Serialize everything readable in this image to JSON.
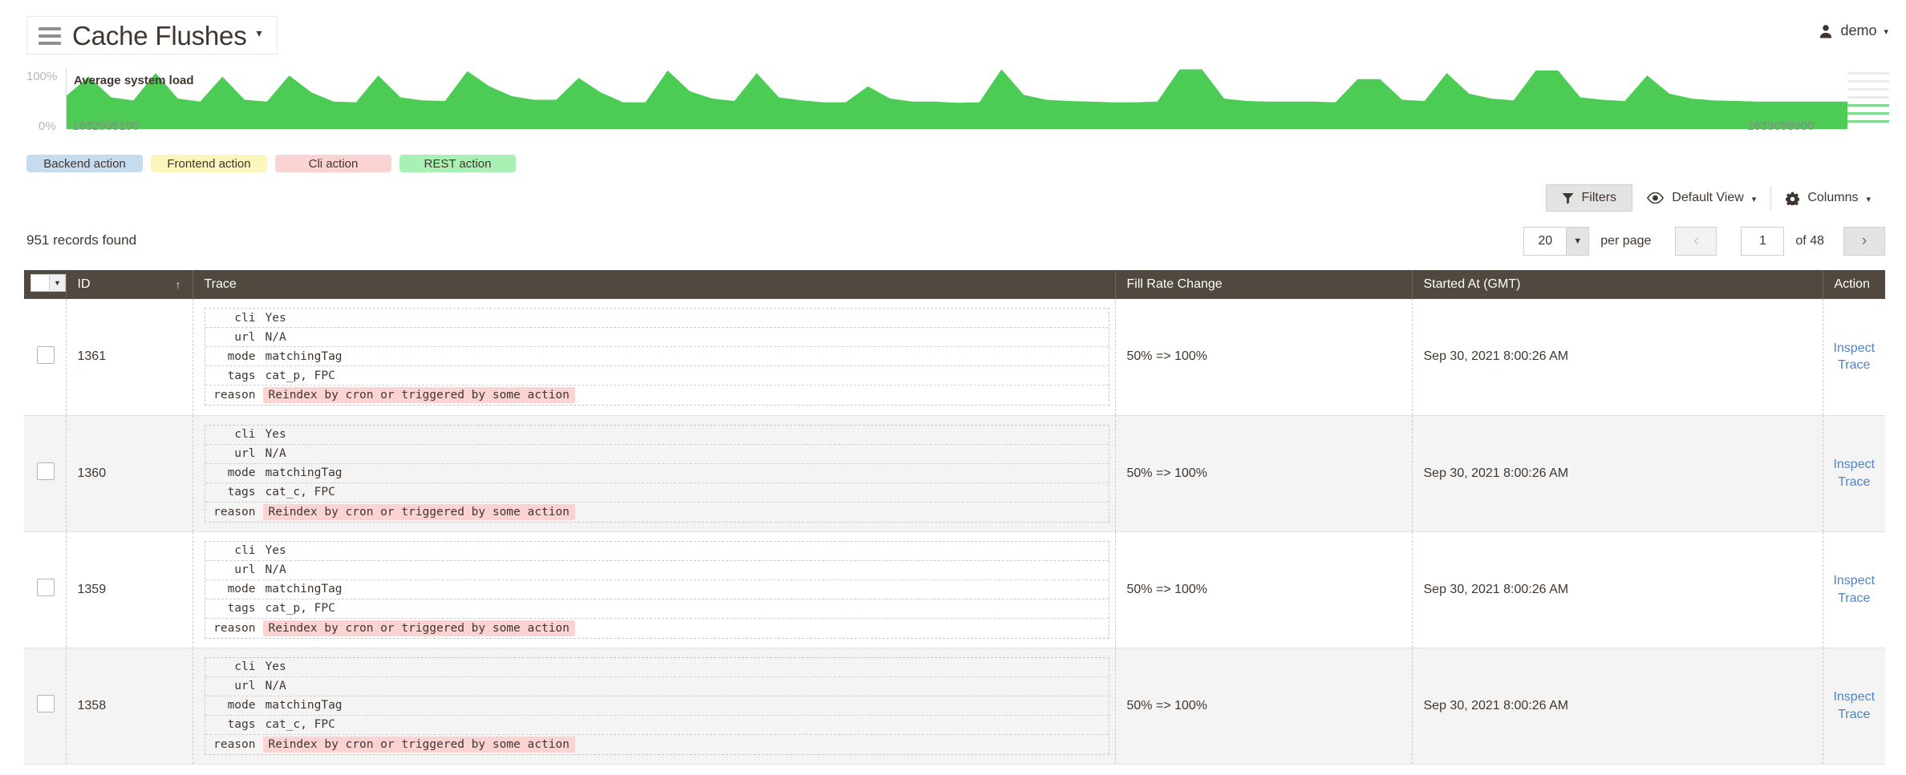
{
  "header": {
    "title": "Cache Flushes",
    "title_caret": "▾",
    "menu_icon": "hamburger-icon",
    "user": {
      "name": "demo",
      "caret": "▾",
      "icon": "user-avatar-icon"
    }
  },
  "chart_data": {
    "type": "area",
    "title": "Average system load",
    "ylabel": "",
    "xlabel": "",
    "y_tick_labels": [
      "100%",
      "0%"
    ],
    "ylim": [
      0,
      100
    ],
    "grid": false,
    "legend_position": "below",
    "series_color": "#4ccb55",
    "x_tick_labels": [
      "1632905100",
      "1633098900"
    ],
    "x": [
      1632905100,
      1633098900
    ],
    "values": [
      55,
      86,
      52,
      47,
      92,
      50,
      45,
      86,
      48,
      45,
      88,
      60,
      45,
      44,
      88,
      52,
      47,
      46,
      95,
      70,
      54,
      48,
      48,
      84,
      60,
      44,
      44,
      96,
      62,
      50,
      46,
      92,
      52,
      47,
      44,
      44,
      70,
      50,
      45,
      45,
      43,
      44,
      98,
      56,
      48,
      46,
      45,
      44,
      44,
      45,
      98,
      98,
      50,
      46,
      45,
      45,
      45,
      44,
      82,
      82,
      48,
      46,
      92,
      58,
      50,
      47,
      96,
      96,
      52,
      48,
      46,
      88,
      58,
      50,
      47,
      46,
      45,
      45,
      45,
      45,
      45
    ],
    "annotations": [
      {
        "text": "Average system load",
        "position": "top-left"
      }
    ]
  },
  "legend": {
    "items": [
      {
        "label": "Backend action",
        "color": "#c5dbf0"
      },
      {
        "label": "Frontend action",
        "color": "#faf6bc"
      },
      {
        "label": "Cli action",
        "color": "#fbd3d3"
      },
      {
        "label": "REST action",
        "color": "#a9f0b4"
      }
    ]
  },
  "toolbar": {
    "filters_label": "Filters",
    "filters_icon": "funnel-icon",
    "view_label": "Default View",
    "view_icon": "eye-icon",
    "view_caret": "▾",
    "columns_label": "Columns",
    "columns_icon": "gear-icon",
    "columns_caret": "▾"
  },
  "summary": {
    "records_found": "951 records found"
  },
  "pagination": {
    "per_page_value": "20",
    "per_page_caret": "▼",
    "per_page_label": "per page",
    "prev_icon": "‹",
    "next_icon": "›",
    "current_page": "1",
    "of_label": "of 48"
  },
  "table": {
    "select_all_caret": "▼",
    "columns": [
      {
        "key": "select",
        "label": ""
      },
      {
        "key": "id",
        "label": "ID",
        "sort": "↑"
      },
      {
        "key": "trace",
        "label": "Trace"
      },
      {
        "key": "fill",
        "label": "Fill Rate Change"
      },
      {
        "key": "started",
        "label": "Started At (GMT)"
      },
      {
        "key": "action",
        "label": "Action"
      }
    ],
    "trace_keys": [
      "cli",
      "url",
      "mode",
      "tags",
      "reason"
    ],
    "action_link": "Inspect Trace",
    "rows": [
      {
        "id": "1361",
        "trace": {
          "cli": "Yes",
          "url": "N/A",
          "mode": "matchingTag",
          "tags": "cat_p, FPC",
          "reason": "Reindex by cron or triggered by some action"
        },
        "fill": "50% => 100%",
        "started": "Sep 30, 2021 8:00:26 AM",
        "action": "Inspect Trace"
      },
      {
        "id": "1360",
        "trace": {
          "cli": "Yes",
          "url": "N/A",
          "mode": "matchingTag",
          "tags": "cat_c, FPC",
          "reason": "Reindex by cron or triggered by some action"
        },
        "fill": "50% => 100%",
        "started": "Sep 30, 2021 8:00:26 AM",
        "action": "Inspect Trace"
      },
      {
        "id": "1359",
        "trace": {
          "cli": "Yes",
          "url": "N/A",
          "mode": "matchingTag",
          "tags": "cat_p, FPC",
          "reason": "Reindex by cron or triggered by some action"
        },
        "fill": "50% => 100%",
        "started": "Sep 30, 2021 8:00:26 AM",
        "action": "Inspect Trace"
      },
      {
        "id": "1358",
        "trace": {
          "cli": "Yes",
          "url": "N/A",
          "mode": "matchingTag",
          "tags": "cat_c, FPC",
          "reason": "Reindex by cron or triggered by some action"
        },
        "fill": "50% => 100%",
        "started": "Sep 30, 2021 8:00:26 AM",
        "action": "Inspect Trace"
      }
    ]
  }
}
